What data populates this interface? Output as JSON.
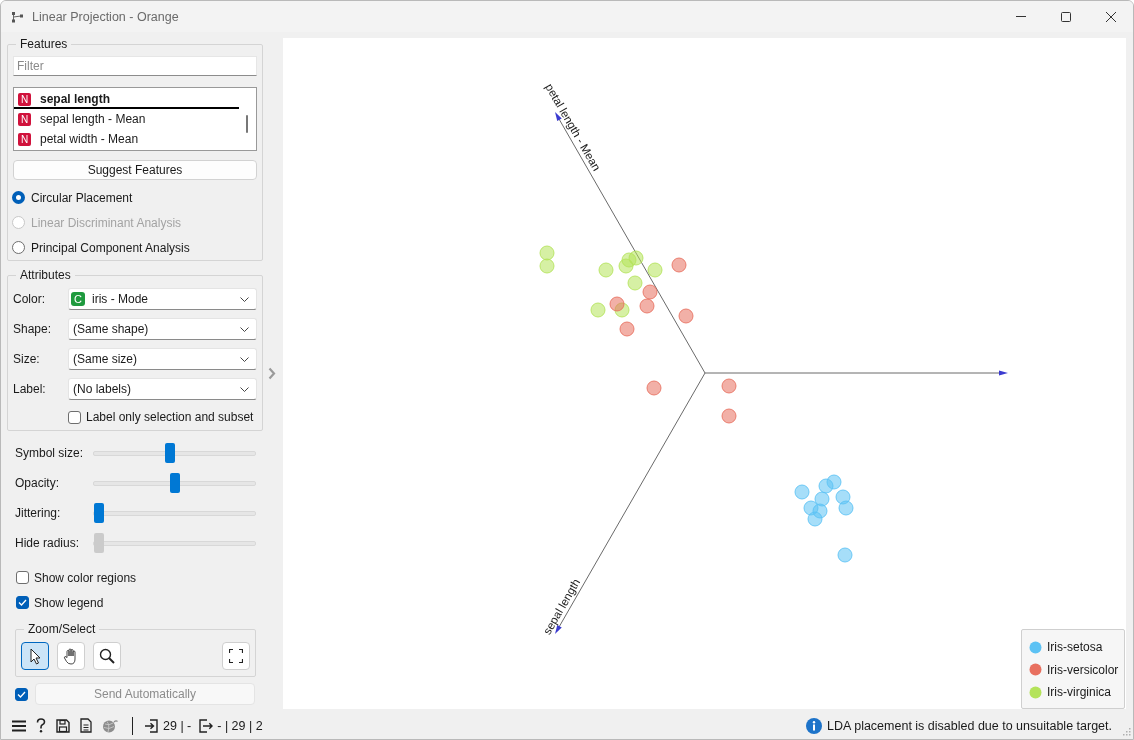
{
  "window": {
    "title": "Linear Projection - Orange"
  },
  "features": {
    "title": "Features",
    "filter": {
      "placeholder": "Filter"
    },
    "items": [
      {
        "badge": {
          "text": "N",
          "kind": "numeric"
        },
        "name": "sepal length",
        "drop_target": true
      },
      {
        "badge": {
          "text": "N",
          "kind": "numeric"
        },
        "name": "sepal length - Mean",
        "drop_target": false
      },
      {
        "badge": {
          "text": "N",
          "kind": "numeric"
        },
        "name": "petal width - Mean",
        "drop_target": false
      }
    ],
    "suggest_button": "Suggest Features",
    "placements": [
      {
        "label": "Circular Placement",
        "selected": true,
        "disabled": false
      },
      {
        "label": "Linear Discriminant Analysis",
        "selected": false,
        "disabled": true
      },
      {
        "label": "Principal Component Analysis",
        "selected": false,
        "disabled": false
      }
    ]
  },
  "attributes": {
    "title": "Attributes",
    "fields": [
      {
        "label": "Color:",
        "value": "iris - Mode",
        "badge": {
          "text": "C",
          "kind": "categorical"
        }
      },
      {
        "label": "Shape:",
        "value": "(Same shape)"
      },
      {
        "label": "Size:",
        "value": "(Same size)"
      },
      {
        "label": "Label:",
        "value": "(No labels)"
      }
    ],
    "label_only": {
      "label": "Label only selection and subset",
      "checked": false
    }
  },
  "sliders": [
    {
      "label": "Symbol size:",
      "level": 0.47,
      "disabled": false
    },
    {
      "label": "Opacity:",
      "level": 0.5,
      "disabled": false
    },
    {
      "label": "Jittering:",
      "level": 0,
      "disabled": false
    },
    {
      "label": "Hide radius:",
      "level": 0,
      "disabled": true
    }
  ],
  "options": [
    {
      "label": "Show color regions",
      "checked": false
    },
    {
      "label": "Show legend",
      "checked": true
    }
  ],
  "zoom_select": {
    "title": "Zoom/Select",
    "tools": [
      {
        "kind": "select",
        "selected": true
      },
      {
        "kind": "pan",
        "selected": false
      },
      {
        "kind": "zoom",
        "selected": false
      }
    ]
  },
  "send": {
    "label": "Send Automatically",
    "checked": true,
    "disabled": true
  },
  "plot": {
    "anchors": [
      {
        "label": "petal length - Mean"
      },
      {
        "label": "sepal length"
      }
    ]
  },
  "legend": {
    "items": [
      {
        "label": "Iris-setosa",
        "color": "#5cc2f4"
      },
      {
        "label": "Iris-versicolor",
        "color": "#e8705f"
      },
      {
        "label": "Iris-virginica",
        "color": "#b4e35a"
      }
    ]
  },
  "status_bar": {
    "input": "29 | -",
    "output": "- | 29 | 2",
    "message": "LDA placement is disabled due to unsuitable target."
  }
}
